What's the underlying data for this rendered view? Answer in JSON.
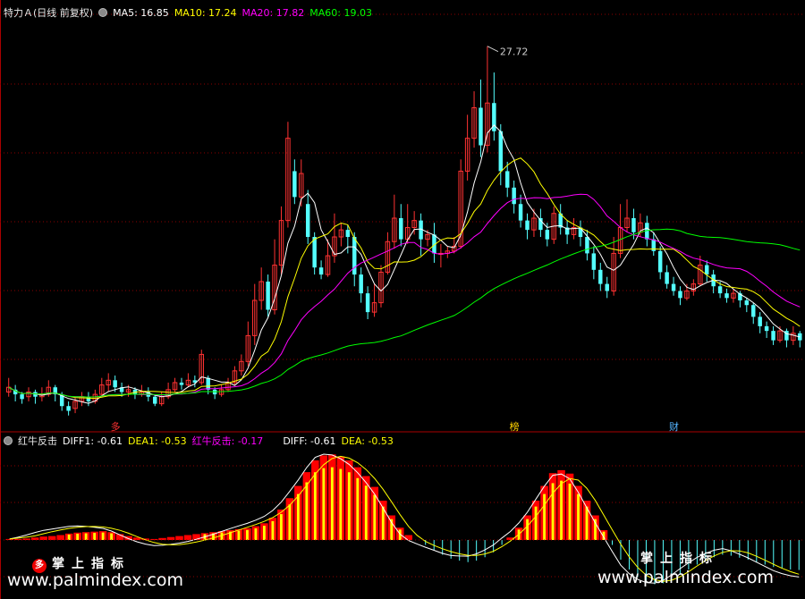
{
  "colors": {
    "up": "#ff3232",
    "down": "#54ffff",
    "ma5": "#ffffff",
    "ma10": "#ffff00",
    "ma20": "#ff00ff",
    "ma60": "#00ff00",
    "axis": "#aa0000",
    "grid": "#8b0000"
  },
  "header": {
    "title": "特力Ａ(日线 前复权)",
    "ma5": "MA5: 16.85",
    "ma10": "MA10: 17.24",
    "ma20": "MA20: 17.82",
    "ma60": "MA60: 19.03",
    "high_label": "27.72"
  },
  "markers": {
    "m1": "多",
    "m2": "榜",
    "m3": "财"
  },
  "indicator": {
    "name": "红牛反击",
    "diff1": "DIFF1: -0.61",
    "dea1": "DEA1: -0.53",
    "hongniu": "红牛反击: -0.17",
    "diff": "DIFF: -0.61",
    "dea": "DEA: -0.53"
  },
  "watermark": {
    "left_cn": "掌上指标",
    "left_url": "www.palmindex.com",
    "right_cn": "掌上指标",
    "right_url": "www.palmindex.com",
    "left_badge": "多"
  },
  "chart_data": {
    "type": "candlestick",
    "price_high_label": 27.72,
    "price_range": [
      11.8,
      29.0
    ],
    "candles": [
      [
        13.0,
        13.2,
        13.6,
        12.8
      ],
      [
        13.1,
        12.9,
        13.3,
        12.6
      ],
      [
        12.9,
        12.7,
        13.0,
        12.5
      ],
      [
        12.8,
        13.0,
        13.2,
        12.6
      ],
      [
        13.0,
        12.8,
        13.1,
        12.5
      ],
      [
        12.8,
        12.9,
        13.2,
        12.6
      ],
      [
        12.9,
        13.2,
        13.5,
        12.8
      ],
      [
        13.2,
        12.9,
        13.3,
        12.6
      ],
      [
        12.9,
        12.4,
        13.0,
        12.2
      ],
      [
        12.4,
        12.2,
        12.6,
        12.0
      ],
      [
        12.3,
        12.6,
        12.8,
        12.1
      ],
      [
        12.6,
        12.8,
        13.0,
        12.4
      ],
      [
        12.8,
        12.6,
        13.0,
        12.4
      ],
      [
        12.6,
        12.9,
        13.1,
        12.5
      ],
      [
        12.9,
        13.3,
        13.6,
        12.8
      ],
      [
        13.3,
        13.5,
        13.8,
        13.0
      ],
      [
        13.5,
        13.2,
        13.7,
        13.0
      ],
      [
        13.2,
        13.0,
        13.4,
        12.8
      ],
      [
        13.0,
        13.1,
        13.3,
        12.8
      ],
      [
        13.1,
        12.9,
        13.2,
        12.7
      ],
      [
        12.9,
        13.0,
        13.3,
        12.8
      ],
      [
        13.0,
        12.8,
        13.2,
        12.6
      ],
      [
        12.8,
        12.5,
        12.9,
        12.4
      ],
      [
        12.5,
        12.8,
        13.0,
        12.4
      ],
      [
        12.8,
        13.1,
        13.4,
        12.7
      ],
      [
        13.1,
        13.4,
        13.6,
        13.0
      ],
      [
        13.4,
        13.3,
        13.6,
        13.1
      ],
      [
        13.3,
        13.5,
        13.8,
        13.2
      ],
      [
        13.5,
        13.4,
        13.7,
        13.2
      ],
      [
        13.4,
        14.6,
        14.8,
        13.3
      ],
      [
        13.6,
        13.1,
        13.7,
        12.9
      ],
      [
        13.1,
        12.9,
        13.2,
        12.7
      ],
      [
        12.9,
        13.1,
        13.3,
        12.8
      ],
      [
        13.1,
        13.4,
        13.6,
        13.0
      ],
      [
        13.4,
        13.9,
        14.1,
        13.3
      ],
      [
        13.9,
        14.3,
        14.6,
        13.7
      ],
      [
        14.3,
        15.4,
        16.0,
        14.1
      ],
      [
        15.4,
        16.9,
        17.6,
        15.0
      ],
      [
        16.9,
        17.7,
        18.3,
        16.5
      ],
      [
        17.7,
        16.5,
        18.0,
        16.2
      ],
      [
        16.5,
        18.4,
        19.5,
        16.3
      ],
      [
        18.4,
        20.3,
        20.9,
        18.0
      ],
      [
        20.3,
        23.8,
        24.5,
        20.0
      ],
      [
        22.4,
        21.3,
        22.9,
        21.0
      ],
      [
        21.3,
        22.3,
        22.9,
        20.9
      ],
      [
        21.0,
        19.6,
        21.6,
        19.3
      ],
      [
        19.6,
        18.3,
        19.8,
        18.0
      ],
      [
        18.3,
        18.0,
        18.6,
        17.8
      ],
      [
        18.0,
        18.8,
        19.5,
        17.9
      ],
      [
        18.8,
        19.6,
        20.6,
        18.5
      ],
      [
        19.6,
        19.9,
        20.2,
        19.2
      ],
      [
        19.9,
        19.6,
        20.1,
        18.9
      ],
      [
        19.6,
        18.0,
        19.8,
        17.5
      ],
      [
        18.0,
        17.2,
        18.3,
        16.8
      ],
      [
        17.2,
        16.4,
        17.5,
        16.1
      ],
      [
        16.4,
        16.8,
        17.6,
        16.2
      ],
      [
        16.8,
        18.1,
        18.4,
        16.6
      ],
      [
        18.1,
        19.4,
        19.8,
        18.0
      ],
      [
        19.4,
        20.4,
        21.4,
        19.1
      ],
      [
        20.4,
        19.5,
        21.0,
        19.2
      ],
      [
        19.5,
        20.0,
        21.0,
        19.3
      ],
      [
        20.0,
        20.3,
        20.7,
        19.7
      ],
      [
        20.3,
        19.5,
        20.6,
        18.8
      ],
      [
        19.5,
        19.7,
        19.9,
        19.2
      ],
      [
        19.7,
        18.9,
        20.2,
        18.5
      ],
      [
        18.9,
        18.9,
        19.3,
        18.3
      ],
      [
        18.9,
        19.0,
        19.2,
        18.7
      ],
      [
        19.0,
        19.2,
        19.6,
        18.9
      ],
      [
        19.2,
        22.4,
        22.9,
        19.1
      ],
      [
        22.4,
        23.8,
        24.8,
        22.0
      ],
      [
        23.8,
        25.1,
        25.8,
        23.4
      ],
      [
        25.1,
        23.5,
        26.3,
        23.0
      ],
      [
        23.5,
        25.3,
        27.72,
        23.2
      ],
      [
        25.3,
        24.1,
        26.6,
        23.7
      ],
      [
        24.1,
        22.4,
        24.4,
        21.8
      ],
      [
        22.4,
        21.7,
        22.8,
        21.3
      ],
      [
        21.7,
        21.0,
        22.0,
        20.6
      ],
      [
        21.0,
        20.3,
        21.4,
        20.0
      ],
      [
        20.3,
        19.9,
        20.6,
        19.5
      ],
      [
        19.9,
        20.4,
        20.8,
        19.6
      ],
      [
        20.4,
        19.9,
        20.8,
        19.6
      ],
      [
        19.9,
        19.5,
        20.2,
        19.2
      ],
      [
        19.5,
        20.6,
        20.9,
        19.3
      ],
      [
        20.6,
        20.0,
        21.0,
        19.7
      ],
      [
        20.0,
        19.7,
        20.3,
        19.3
      ],
      [
        19.7,
        20.0,
        20.4,
        19.5
      ],
      [
        20.0,
        19.6,
        20.3,
        19.2
      ],
      [
        19.6,
        18.9,
        19.9,
        18.6
      ],
      [
        18.9,
        18.2,
        19.2,
        17.8
      ],
      [
        18.2,
        17.6,
        18.5,
        17.3
      ],
      [
        17.6,
        17.3,
        17.9,
        17.0
      ],
      [
        17.3,
        18.9,
        19.6,
        17.1
      ],
      [
        18.9,
        20.0,
        21.0,
        18.7
      ],
      [
        20.0,
        20.4,
        21.2,
        19.8
      ],
      [
        20.4,
        19.8,
        20.8,
        19.5
      ],
      [
        19.8,
        20.2,
        20.6,
        19.6
      ],
      [
        20.2,
        19.5,
        20.5,
        19.2
      ],
      [
        19.5,
        19.0,
        19.8,
        18.8
      ],
      [
        19.0,
        18.1,
        19.2,
        17.8
      ],
      [
        18.1,
        17.6,
        18.4,
        17.4
      ],
      [
        17.6,
        17.3,
        17.9,
        17.1
      ],
      [
        17.3,
        17.0,
        17.5,
        16.7
      ],
      [
        17.0,
        17.3,
        17.6,
        16.9
      ],
      [
        17.3,
        17.6,
        17.8,
        17.1
      ],
      [
        17.6,
        18.4,
        18.8,
        17.5
      ],
      [
        18.4,
        18.0,
        18.6,
        17.7
      ],
      [
        18.0,
        17.5,
        18.2,
        17.2
      ],
      [
        17.5,
        17.2,
        17.7,
        17.0
      ],
      [
        17.2,
        17.0,
        17.4,
        16.8
      ],
      [
        17.0,
        17.2,
        17.4,
        16.8
      ],
      [
        17.2,
        16.9,
        17.3,
        16.6
      ],
      [
        16.9,
        16.7,
        17.0,
        16.4
      ],
      [
        16.7,
        16.2,
        16.8,
        15.9
      ],
      [
        16.2,
        15.8,
        16.4,
        15.5
      ],
      [
        15.8,
        15.6,
        16.0,
        15.3
      ],
      [
        15.6,
        15.2,
        15.8,
        15.0
      ],
      [
        15.2,
        15.6,
        15.8,
        15.1
      ],
      [
        15.6,
        15.2,
        15.7,
        14.9
      ],
      [
        15.2,
        15.5,
        15.8,
        15.0
      ],
      [
        15.5,
        15.2,
        15.6,
        14.9
      ]
    ],
    "indicator_series": {
      "bars_red": [
        0.02,
        0.02,
        0.03,
        0.05,
        0.07,
        0.08,
        0.1,
        0.13,
        0.15,
        0.16,
        0.17,
        0.18,
        0.16,
        0.12,
        0.08,
        0.05,
        0.03,
        0.02,
        0.04,
        0.06,
        0.08,
        0.1,
        0.12,
        0.14,
        0.16,
        0.18,
        0.2,
        0.22,
        0.24,
        0.28,
        0.34,
        0.45,
        0.62,
        0.85,
        1.1,
        1.38,
        1.62,
        1.72,
        1.74,
        1.7,
        1.62,
        1.48,
        1.3,
        1.08,
        0.8,
        0.5,
        0.25,
        0.1,
        0.0,
        -0.1,
        -0.2,
        -0.3,
        -0.38,
        -0.42,
        -0.45,
        -0.42,
        -0.35,
        -0.25,
        -0.1,
        0.05,
        0.25,
        0.5,
        0.8,
        1.1,
        1.36,
        1.42,
        1.35,
        1.1,
        0.8,
        0.5,
        0.2,
        -0.1,
        -0.4,
        -0.6,
        -0.75,
        -0.85,
        -0.9,
        -0.88,
        -0.8,
        -0.7,
        -0.6,
        -0.5,
        -0.42,
        -0.35,
        -0.3,
        -0.32,
        -0.36,
        -0.4,
        -0.45,
        -0.5,
        -0.55,
        -0.58,
        -0.6,
        -0.61
      ]
    }
  }
}
